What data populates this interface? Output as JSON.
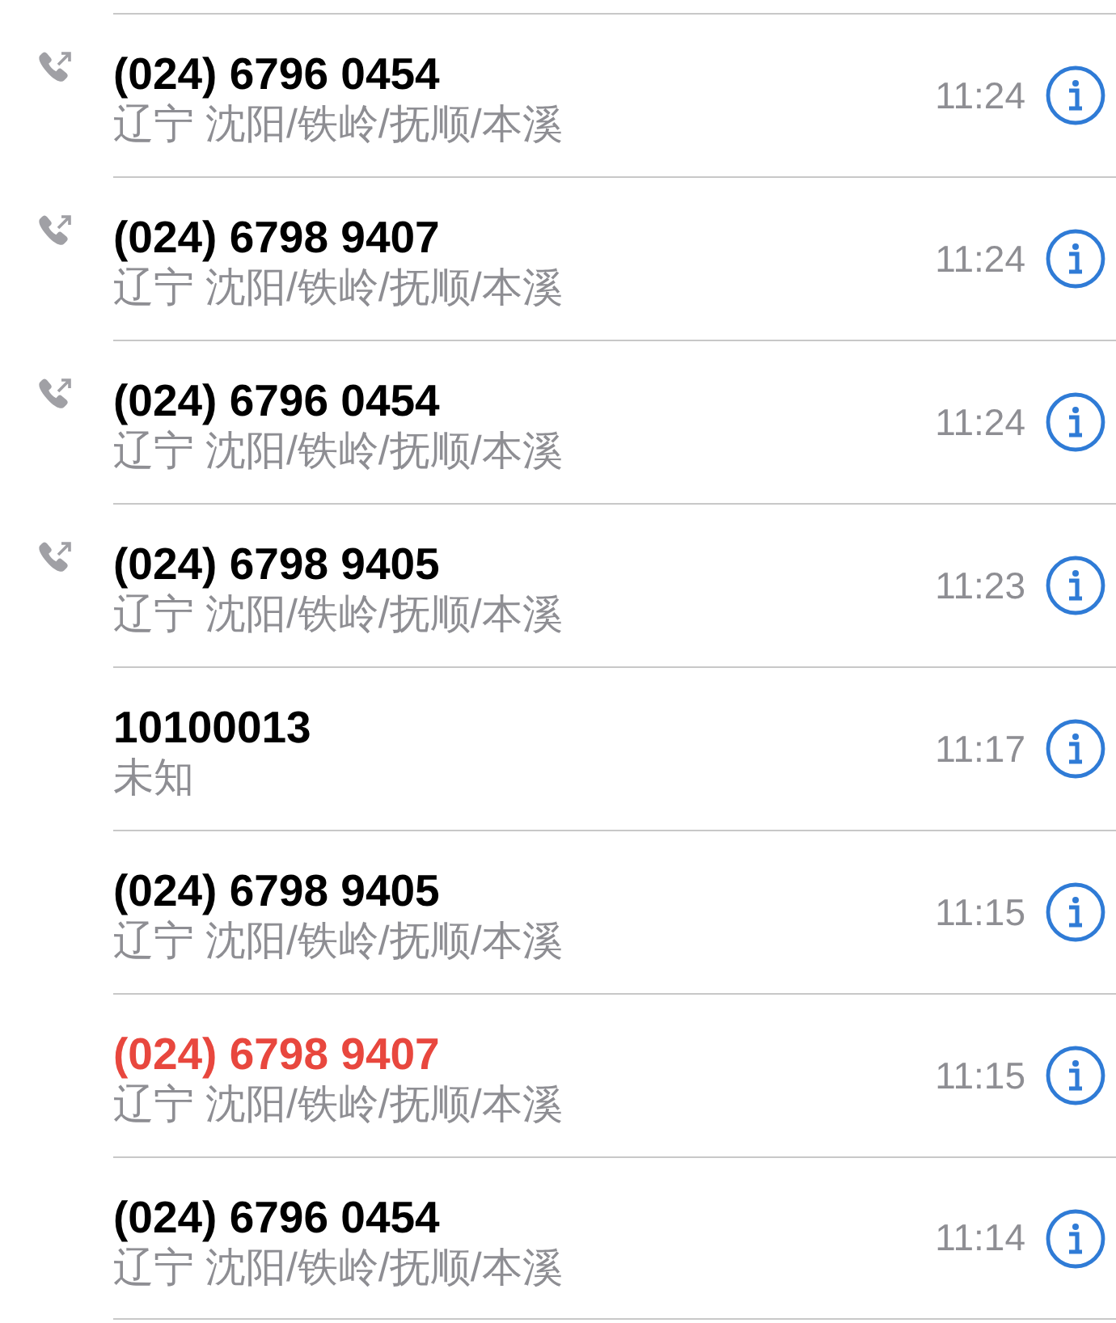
{
  "calls": [
    {
      "number": "(024) 6796 0454",
      "location": "辽宁 沈阳/铁岭/抚顺/本溪",
      "time": "11:24",
      "outgoing": true,
      "missed": false
    },
    {
      "number": "(024) 6798 9407",
      "location": "辽宁 沈阳/铁岭/抚顺/本溪",
      "time": "11:24",
      "outgoing": true,
      "missed": false
    },
    {
      "number": "(024) 6796 0454",
      "location": "辽宁 沈阳/铁岭/抚顺/本溪",
      "time": "11:24",
      "outgoing": true,
      "missed": false
    },
    {
      "number": "(024) 6798 9405",
      "location": "辽宁 沈阳/铁岭/抚顺/本溪",
      "time": "11:23",
      "outgoing": true,
      "missed": false
    },
    {
      "number": "10100013",
      "location": "未知",
      "time": "11:17",
      "outgoing": false,
      "missed": false
    },
    {
      "number": "(024) 6798 9405",
      "location": "辽宁 沈阳/铁岭/抚顺/本溪",
      "time": "11:15",
      "outgoing": false,
      "missed": false
    },
    {
      "number": "(024) 6798 9407",
      "location": "辽宁 沈阳/铁岭/抚顺/本溪",
      "time": "11:15",
      "outgoing": false,
      "missed": true
    },
    {
      "number": "(024) 6796 0454",
      "location": "辽宁 沈阳/铁岭/抚顺/本溪",
      "time": "11:14",
      "outgoing": false,
      "missed": false
    }
  ]
}
